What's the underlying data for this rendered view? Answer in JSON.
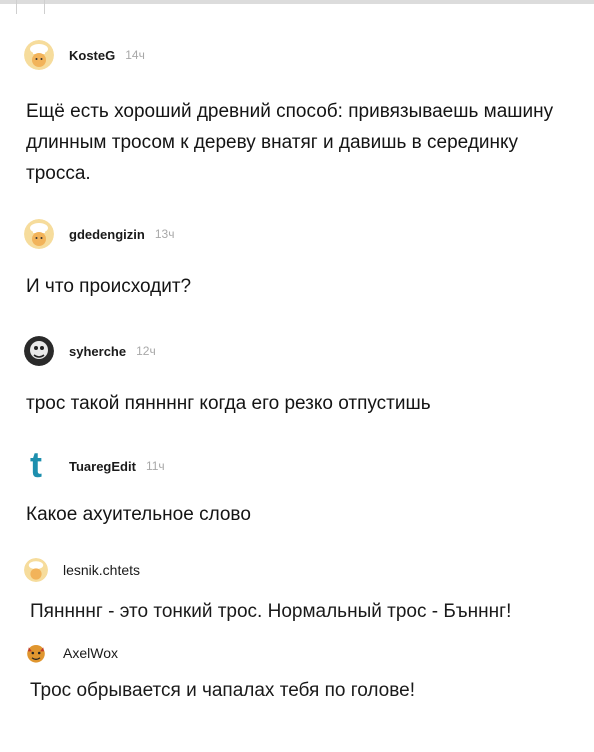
{
  "comments": [
    {
      "author": "KosteG",
      "time": "14ч",
      "text": "Ещё есть хороший древний способ: привязываешь машину длинным тросом к дереву внатяг и давишь в серединку тросса.",
      "avatar": "chef-avatar-icon"
    },
    {
      "author": "gdedengizin",
      "time": "13ч",
      "text": "И что происходит?",
      "avatar": "chef-avatar-icon"
    },
    {
      "author": "syherche",
      "time": "12ч",
      "text": "трос такой пяннннг когда его резко отпустишь",
      "avatar": "photo-avatar-icon"
    },
    {
      "author": "TuaregEdit",
      "time": "11ч",
      "text": "Какое ахуительное слово",
      "avatar": "letter-t-avatar-icon"
    },
    {
      "author": "lesnik.chtets",
      "text": "Пяннннг - это тонкий трос. Нормальный трос - Бънннг!",
      "avatar": "chef-avatar-icon"
    },
    {
      "author": "AxelWox",
      "text": "Трос обрывается и чапалах тебя по голове!",
      "avatar": "devil-avatar-icon"
    }
  ],
  "colors": {
    "accent_teal": "#1d8fae",
    "avatar_bg": "#f6dc9c",
    "time_gray": "#a8a8a8"
  }
}
